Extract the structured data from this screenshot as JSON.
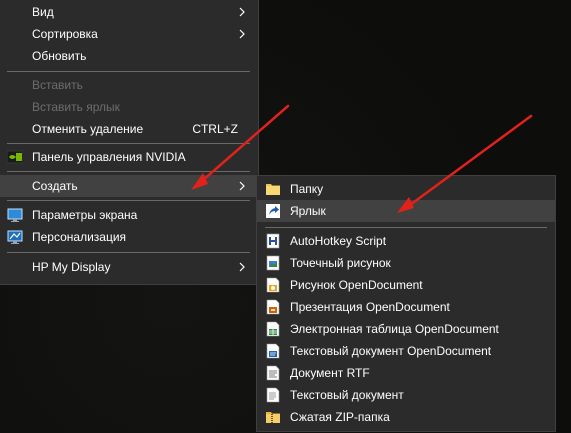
{
  "context_menu": {
    "items": [
      {
        "label": "Вид"
      },
      {
        "label": "Сортировка"
      },
      {
        "label": "Обновить"
      },
      {
        "label": "Вставить"
      },
      {
        "label": "Вставить ярлык"
      },
      {
        "label": "Отменить удаление",
        "shortcut": "CTRL+Z"
      },
      {
        "label": "Панель управления NVIDIA"
      },
      {
        "label": "Создать"
      },
      {
        "label": "Параметры экрана"
      },
      {
        "label": "Персонализация"
      },
      {
        "label": "HP My Display"
      }
    ]
  },
  "create_submenu": {
    "items": [
      {
        "label": "Папку",
        "icon": "folder-icon"
      },
      {
        "label": "Ярлык",
        "icon": "shortcut-icon"
      },
      {
        "label": "AutoHotkey Script",
        "icon": "autohotkey-icon"
      },
      {
        "label": "Точечный рисунок",
        "icon": "bitmap-icon"
      },
      {
        "label": "Рисунок OpenDocument",
        "icon": "odg-icon"
      },
      {
        "label": "Презентация OpenDocument",
        "icon": "odp-icon"
      },
      {
        "label": "Электронная таблица OpenDocument",
        "icon": "ods-icon"
      },
      {
        "label": "Текстовый документ OpenDocument",
        "icon": "odt-icon"
      },
      {
        "label": "Документ RTF",
        "icon": "rtf-icon"
      },
      {
        "label": "Текстовый документ",
        "icon": "txt-icon"
      },
      {
        "label": "Сжатая ZIP-папка",
        "icon": "zip-icon"
      }
    ]
  },
  "colors": {
    "menu_bg": "#2b2b2b",
    "highlight_bg": "#414141",
    "disabled_text": "#6d6d6d",
    "annotation_arrow": "#e0221b"
  }
}
